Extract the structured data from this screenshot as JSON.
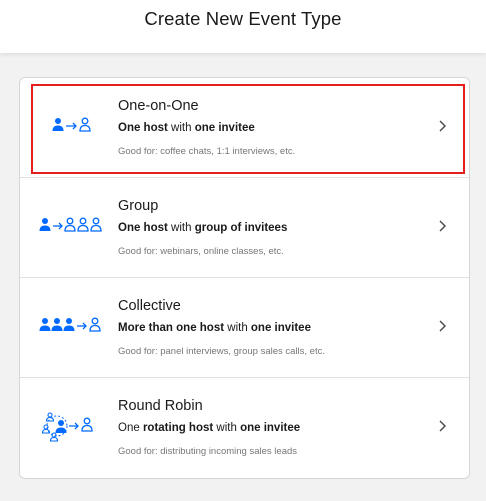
{
  "header": {
    "title": "Create New Event Type"
  },
  "colors": {
    "accent": "#0069ff",
    "selected_border": "#e51d1d",
    "muted": "#777777"
  },
  "event_types": [
    {
      "name": "One-on-One",
      "desc": [
        {
          "text": "One host",
          "bold": true
        },
        {
          "text": " with ",
          "bold": false
        },
        {
          "text": "one invitee",
          "bold": true
        }
      ],
      "good_for": "Good for: coffee chats, 1:1 interviews, etc.",
      "icon": "one-on-one-icon",
      "selected": true
    },
    {
      "name": "Group",
      "desc": [
        {
          "text": "One host",
          "bold": true
        },
        {
          "text": " with ",
          "bold": false
        },
        {
          "text": "group of invitees",
          "bold": true
        }
      ],
      "good_for": "Good for: webinars, online classes, etc.",
      "icon": "group-icon",
      "selected": false
    },
    {
      "name": "Collective",
      "desc": [
        {
          "text": "More than one host",
          "bold": true
        },
        {
          "text": " with ",
          "bold": false
        },
        {
          "text": "one invitee",
          "bold": true
        }
      ],
      "good_for": "Good for: panel interviews, group sales calls, etc.",
      "icon": "collective-icon",
      "selected": false
    },
    {
      "name": "Round Robin",
      "desc": [
        {
          "text": "One ",
          "bold": false
        },
        {
          "text": "rotating host",
          "bold": true
        },
        {
          "text": " with ",
          "bold": false
        },
        {
          "text": "one invitee",
          "bold": true
        }
      ],
      "good_for": "Good for: distributing incoming sales leads",
      "icon": "round-robin-icon",
      "selected": false
    }
  ]
}
